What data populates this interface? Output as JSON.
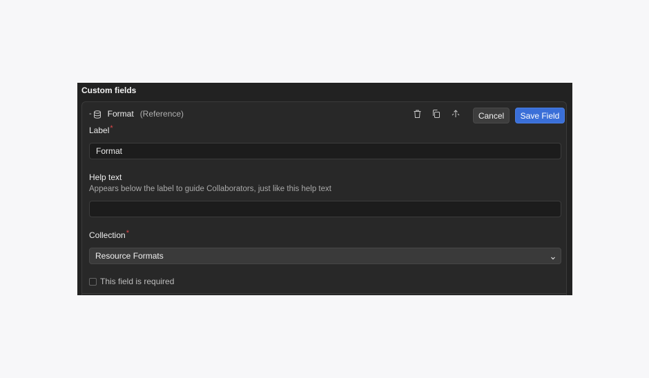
{
  "panel": {
    "title": "Custom fields"
  },
  "field": {
    "name": "Format",
    "type": "(Reference)",
    "icons": [
      "drag-handle-icon",
      "database-icon",
      "trash-icon",
      "duplicate-icon",
      "move-icon"
    ],
    "cancel_label": "Cancel",
    "save_label": "Save Field"
  },
  "form": {
    "label": {
      "title": "Label",
      "required_mark": "*",
      "value": "Format"
    },
    "help_text": {
      "title": "Help text",
      "description": "Appears below the label to guide Collaborators, just like this help text",
      "value": ""
    },
    "collection": {
      "title": "Collection",
      "required_mark": "*",
      "selected": "Resource Formats"
    },
    "required_checkbox": {
      "label": "This field is required",
      "checked": false
    }
  },
  "colors": {
    "accent": "#3a6fd8",
    "required": "#e0484a",
    "panel_bg": "#222222",
    "page_bg": "#f7f7f9"
  }
}
